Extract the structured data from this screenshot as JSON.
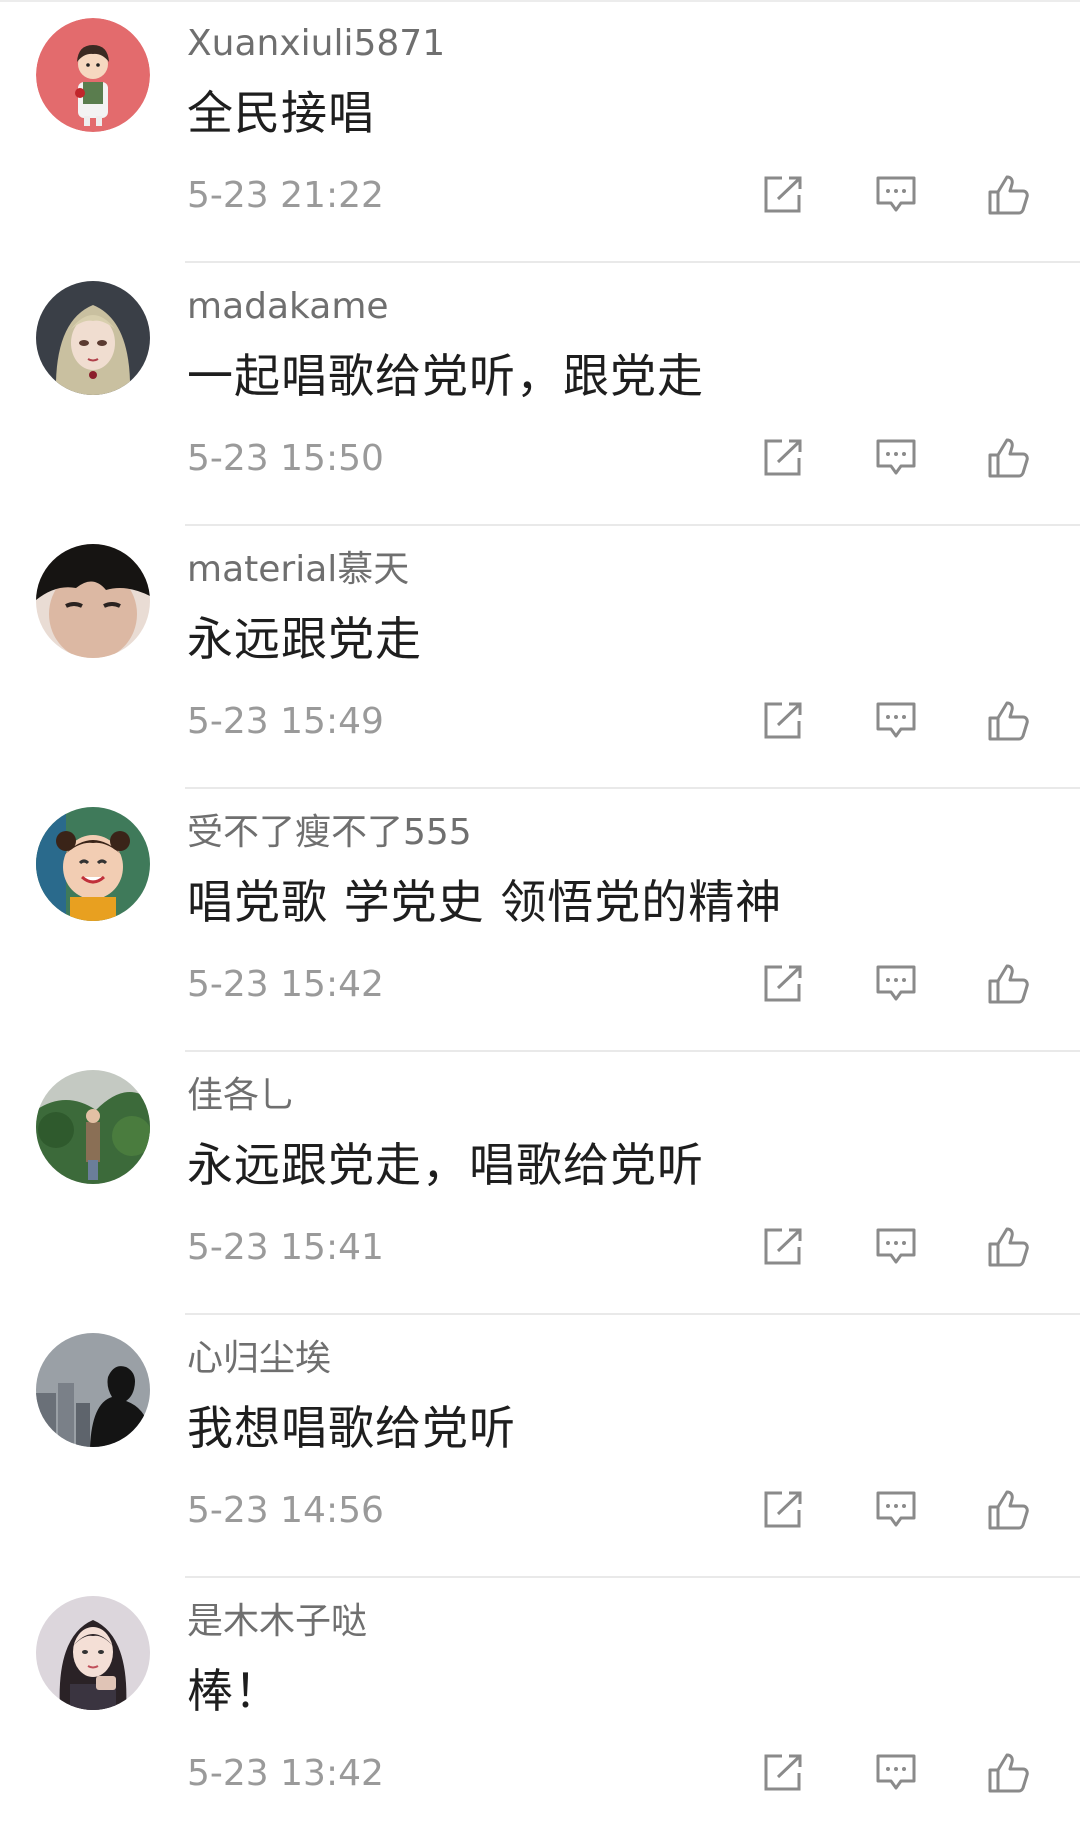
{
  "comments": [
    {
      "username": "Xuanxiuli5871",
      "content": "全民接唱",
      "time": "5-23 21:22",
      "avatar": "cartoon-boy-red-avatar"
    },
    {
      "username": "madakame",
      "content": " 一起唱歌给党听，跟党走",
      "time": "5-23 15:50",
      "avatar": "anime-girl-avatar"
    },
    {
      "username": "material慕天",
      "content": "永远跟党走",
      "time": "5-23 15:49",
      "avatar": "person-face-avatar"
    },
    {
      "username": "受不了瘦不了555",
      "content": "唱党歌  学党史  领悟党的精神",
      "time": "5-23 15:42",
      "avatar": "child-avatar"
    },
    {
      "username": "佳各乚",
      "content": "永远跟党走，唱歌给党听",
      "time": "5-23 15:41",
      "avatar": "outdoor-person-avatar"
    },
    {
      "username": "心归尘埃",
      "content": "我想唱歌给党听",
      "time": "5-23 14:56",
      "avatar": "city-silhouette-avatar"
    },
    {
      "username": "是木木子哒",
      "content": "棒！",
      "time": "5-23 13:42",
      "avatar": "girl-photo-avatar"
    }
  ],
  "actions": {
    "share_icon": "share-icon",
    "reply_icon": "comment-icon",
    "like_icon": "thumbs-up-icon"
  },
  "colors": {
    "username": "#6f6f6f",
    "content": "#1e1e1e",
    "time": "#9a9a9a",
    "icon": "#8a8a8a",
    "divider": "#e9e9e9"
  }
}
